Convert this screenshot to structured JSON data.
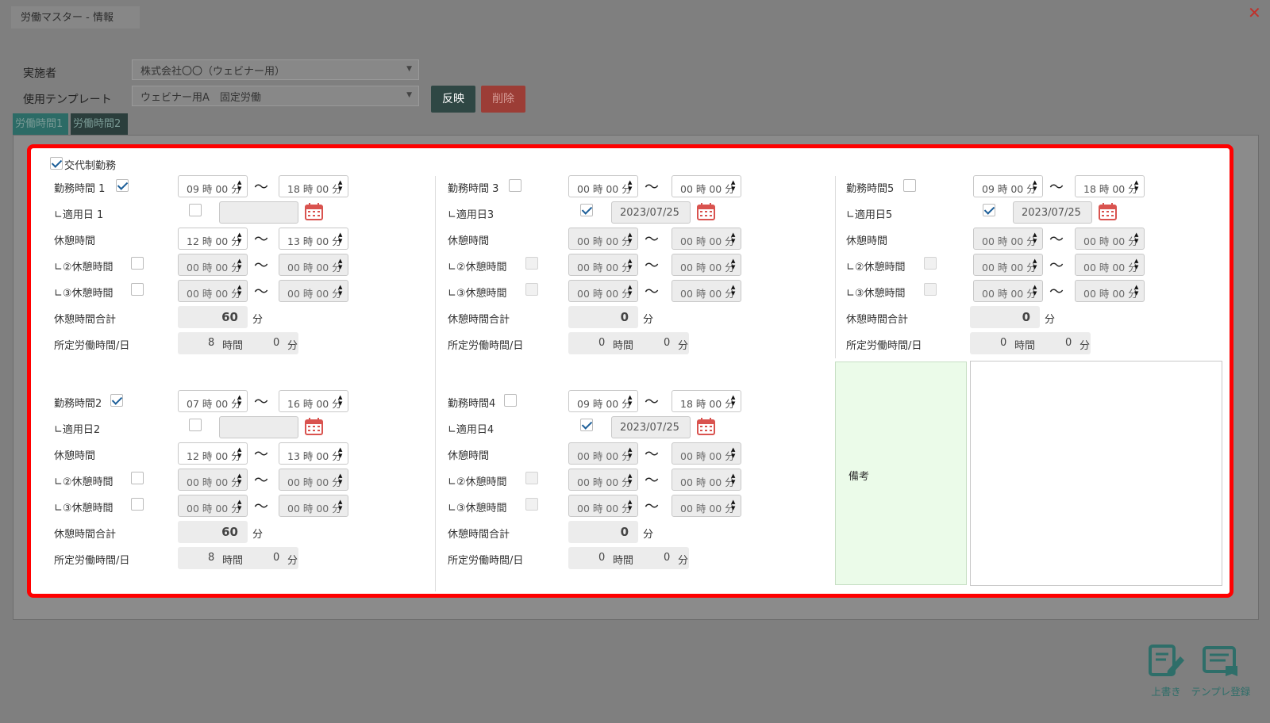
{
  "window": {
    "title": "労働マスター - 情報",
    "close": "✕"
  },
  "header": {
    "implementer_label": "実施者",
    "implementer_value": "株式会社〇〇（ウェビナー用）",
    "template_label": "使用テンプレート",
    "template_value": "ウェビナー用A　固定労働",
    "apply_button": "反映",
    "delete_button": "削除"
  },
  "tabs": [
    "労働時間1",
    "労働時間2"
  ],
  "shift_checkbox_label": "交代制勤務",
  "labels": {
    "tilde": "〜",
    "break": "休憩時間",
    "break2": "∟②休憩時間",
    "break3": "∟③休憩時間",
    "break_total": "休憩時間合計",
    "work_per_day": "所定労働時間/日",
    "minutes_unit": "分",
    "hours_unit": "時間",
    "spin_up": "▲",
    "spin_down": "▼"
  },
  "blocks": [
    {
      "title": "勤務時間 1",
      "title_checked": true,
      "apply_label": "∟適用日 1",
      "apply_checked": false,
      "date": "",
      "work_start": "09 時 00 分",
      "work_end": "18 時 00 分",
      "break_start": "12 時 00 分",
      "break_end": "13 時 00 分",
      "break2_start": "00 時 00 分",
      "break2_end": "00 時 00 分",
      "break3_start": "00 時 00 分",
      "break3_end": "00 時 00 分",
      "break_total": "60",
      "work_hours": "8",
      "work_minutes": "0"
    },
    {
      "title": "勤務時間2",
      "title_checked": true,
      "apply_label": "∟適用日2",
      "apply_checked": false,
      "date": "",
      "work_start": "07 時 00 分",
      "work_end": "16 時 00 分",
      "break_start": "12 時 00 分",
      "break_end": "13 時 00 分",
      "break2_start": "00 時 00 分",
      "break2_end": "00 時 00 分",
      "break3_start": "00 時 00 分",
      "break3_end": "00 時 00 分",
      "break_total": "60",
      "work_hours": "8",
      "work_minutes": "0"
    },
    {
      "title": "勤務時間 3",
      "title_checked": false,
      "apply_label": "∟適用日3",
      "apply_checked": true,
      "date": "2023/07/25",
      "work_start": "00 時 00 分",
      "work_end": "00 時 00 分",
      "break_start": "00 時 00 分",
      "break_end": "00 時 00 分",
      "break2_start": "00 時 00 分",
      "break2_end": "00 時 00 分",
      "break3_start": "00 時 00 分",
      "break3_end": "00 時 00 分",
      "break_total": "0",
      "work_hours": "0",
      "work_minutes": "0"
    },
    {
      "title": "勤務時間4",
      "title_checked": false,
      "apply_label": "∟適用日4",
      "apply_checked": true,
      "date": "2023/07/25",
      "work_start": "09 時 00 分",
      "work_end": "18 時 00 分",
      "break_start": "00 時 00 分",
      "break_end": "00 時 00 分",
      "break2_start": "00 時 00 分",
      "break2_end": "00 時 00 分",
      "break3_start": "00 時 00 分",
      "break3_end": "00 時 00 分",
      "break_total": "0",
      "work_hours": "0",
      "work_minutes": "0"
    },
    {
      "title": "勤務時間5",
      "title_checked": false,
      "apply_label": "∟適用日5",
      "apply_checked": true,
      "date": "2023/07/25",
      "work_start": "09 時 00 分",
      "work_end": "18 時 00 分",
      "break_start": "00 時 00 分",
      "break_end": "00 時 00 分",
      "break2_start": "00 時 00 分",
      "break2_end": "00 時 00 分",
      "break3_start": "00 時 00 分",
      "break3_end": "00 時 00 分",
      "break_total": "0",
      "work_hours": "0",
      "work_minutes": "0"
    }
  ],
  "remarks_label": "備考",
  "footer": {
    "overwrite_label": "上書き",
    "template_register_label": "テンプレ登録"
  }
}
